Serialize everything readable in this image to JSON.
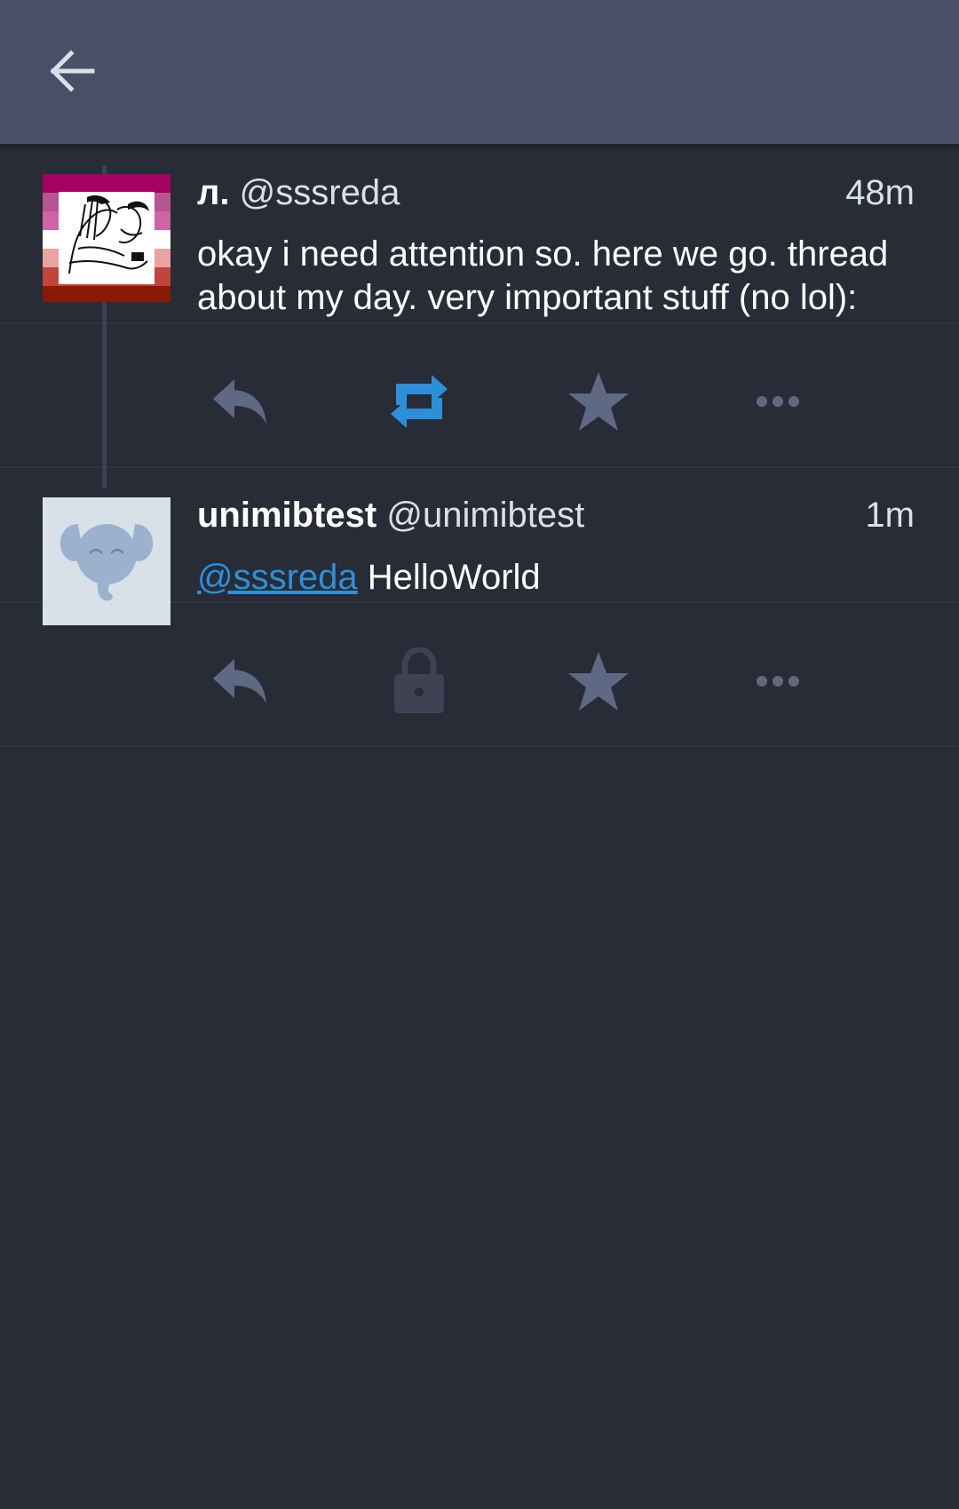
{
  "header": {
    "back_icon": "arrow-left-icon"
  },
  "colors": {
    "appbar": "#4a4f67",
    "background": "#282c37",
    "action": "#606984",
    "boost_active": "#2b90d9",
    "lock": "#3e4253",
    "link": "#2b90d9"
  },
  "statuses": [
    {
      "display_name": "л.",
      "acct": "@sssreda",
      "time": "48m",
      "content": "okay i need attention so. here we go. thread about my day. very important stuff (no lol):",
      "avatar": "lesbian-flag-drawing-avatar",
      "actions": {
        "reply": "reply-icon",
        "boost": "boost-icon",
        "boost_active": true,
        "favourite": "star-icon",
        "more": "more-icon"
      }
    },
    {
      "display_name": "unimibtest",
      "acct": "@unimibtest",
      "time": "1m",
      "mention": "@sssreda",
      "content": "HelloWorld",
      "avatar": "elephant-avatar",
      "actions": {
        "reply": "reply-icon",
        "boost": "lock-icon",
        "boost_active": false,
        "favourite": "star-icon",
        "more": "more-icon"
      }
    }
  ]
}
